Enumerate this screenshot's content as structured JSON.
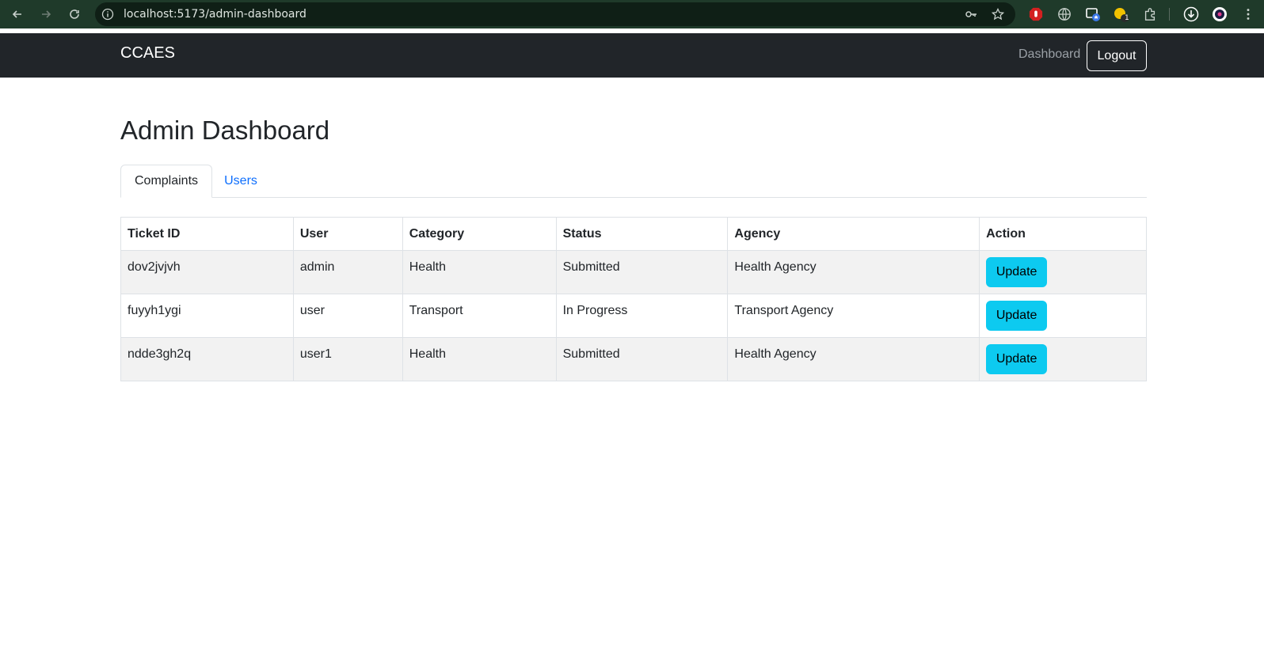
{
  "browser": {
    "url": "localhost:5173/admin-dashboard",
    "badge_count": "1"
  },
  "navbar": {
    "brand": "CCAES",
    "dashboard_link": "Dashboard",
    "logout_label": "Logout"
  },
  "page": {
    "title": "Admin Dashboard"
  },
  "tabs": [
    {
      "label": "Complaints",
      "active": true
    },
    {
      "label": "Users",
      "active": false
    }
  ],
  "table": {
    "headers": [
      "Ticket ID",
      "User",
      "Category",
      "Status",
      "Agency",
      "Action"
    ],
    "rows": [
      {
        "ticket_id": "dov2jvjvh",
        "user": "admin",
        "category": "Health",
        "status": "Submitted",
        "agency": "Health Agency",
        "action": "Update"
      },
      {
        "ticket_id": "fuyyh1ygi",
        "user": "user",
        "category": "Transport",
        "status": "In Progress",
        "agency": "Transport Agency",
        "action": "Update"
      },
      {
        "ticket_id": "ndde3gh2q",
        "user": "user1",
        "category": "Health",
        "status": "Submitted",
        "agency": "Health Agency",
        "action": "Update"
      }
    ]
  },
  "colors": {
    "navbar_bg": "#212529",
    "update_button": "#0dcaf0",
    "link": "#0d6efd"
  }
}
